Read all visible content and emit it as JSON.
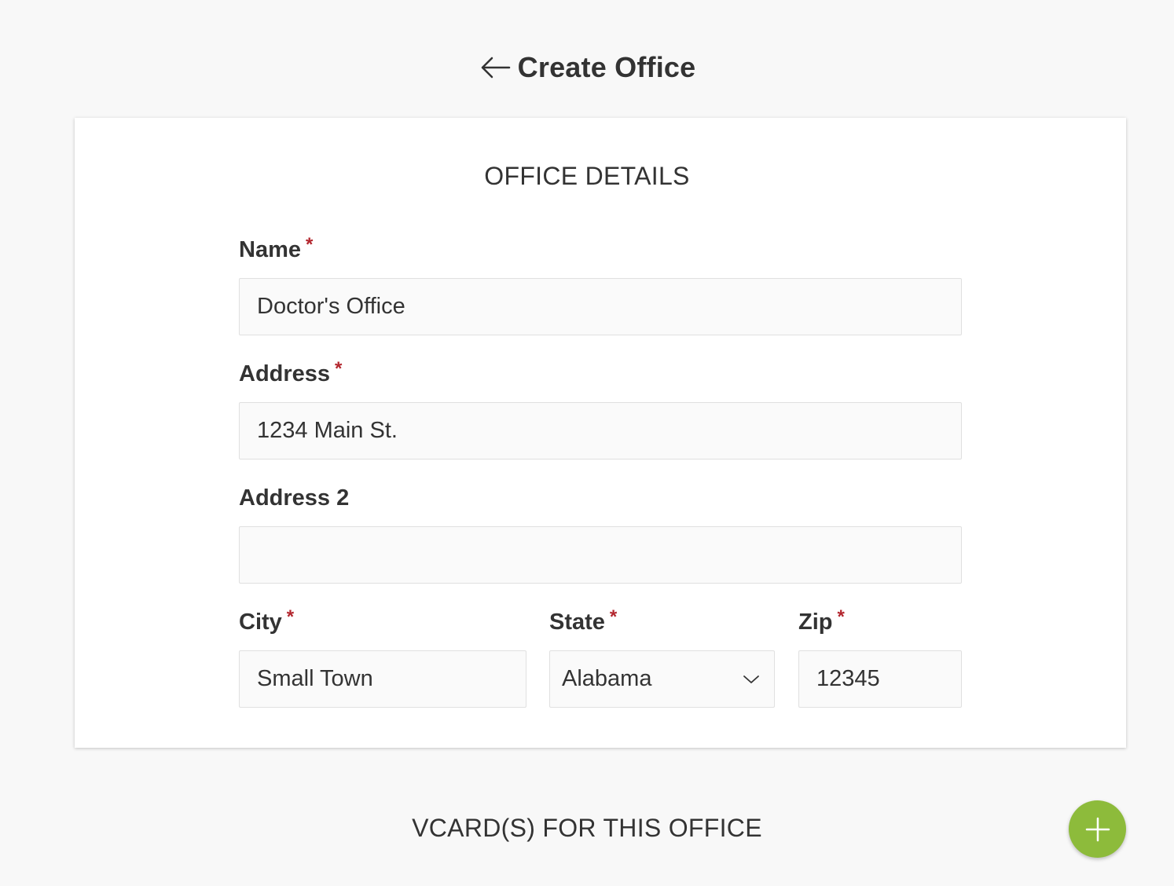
{
  "header": {
    "title": "Create Office",
    "back_icon": "arrow-left-icon"
  },
  "office_details": {
    "section_title": "OFFICE DETAILS",
    "required_marker": "*",
    "name": {
      "label": "Name",
      "value": "Doctor's Office",
      "required": true
    },
    "address": {
      "label": "Address",
      "value": "1234 Main St.",
      "required": true
    },
    "address2": {
      "label": "Address 2",
      "value": "",
      "required": false
    },
    "city": {
      "label": "City",
      "value": "Small Town",
      "required": true
    },
    "state": {
      "label": "State",
      "value": "Alabama",
      "required": true,
      "icon": "chevron-down-icon"
    },
    "zip": {
      "label": "Zip",
      "value": "12345",
      "required": true
    }
  },
  "vcards": {
    "section_title": "VCARD(S) FOR THIS OFFICE",
    "add_icon": "plus-icon"
  },
  "colors": {
    "background": "#f8f8f8",
    "required": "#b3262e",
    "fab": "#8dbb3b",
    "text": "#333333"
  }
}
